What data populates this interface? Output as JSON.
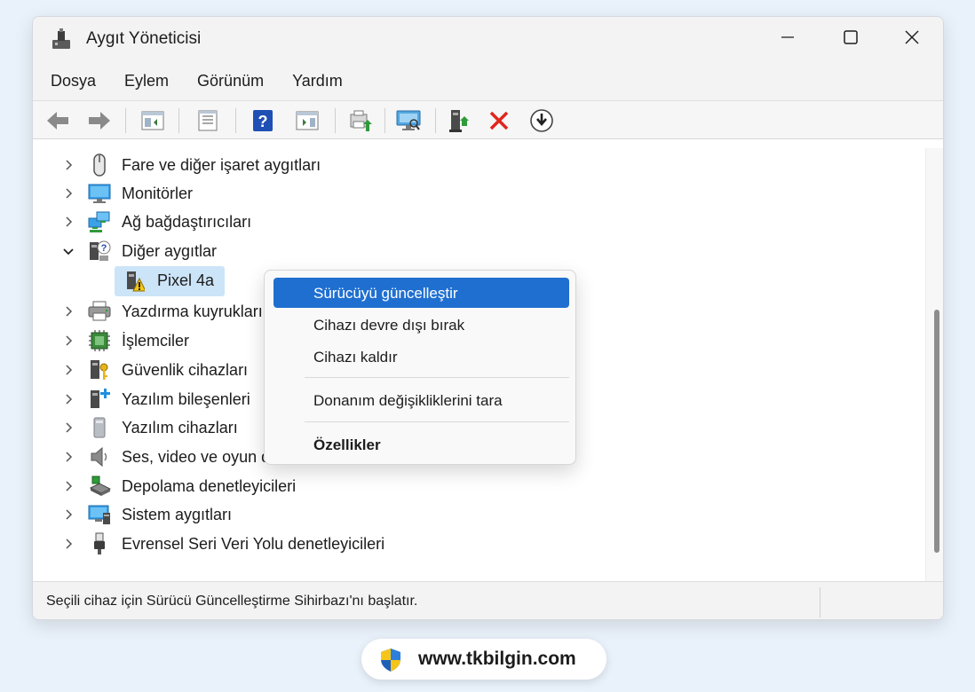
{
  "window": {
    "title": "Aygıt Yöneticisi",
    "app_icon": "device-manager-icon",
    "controls": [
      "minimize-icon",
      "maximize-icon",
      "close-icon"
    ]
  },
  "menu": {
    "items": [
      "Dosya",
      "Eylem",
      "Görünüm",
      "Yardım"
    ]
  },
  "toolbar": {
    "buttons": [
      "back-arrow-icon",
      "forward-arrow-icon",
      "show-hide-console-tree-icon",
      "properties-icon",
      "help-icon",
      "action-pane-icon",
      "update-driver-icon",
      "scan-hardware-icon",
      "enable-device-icon",
      "uninstall-device-icon",
      "download-driver-icon"
    ]
  },
  "tree": {
    "items": [
      {
        "label": "Fare ve diğer işaret aygıtları",
        "icon": "mouse-icon",
        "expanded": false
      },
      {
        "label": "Monitörler",
        "icon": "monitor-icon",
        "expanded": false
      },
      {
        "label": "Ağ bağdaştırıcıları",
        "icon": "network-adapter-icon",
        "expanded": false
      },
      {
        "label": "Diğer aygıtlar",
        "icon": "other-devices-icon",
        "expanded": true
      },
      {
        "label": "Pixel 4a",
        "icon": "warning-device-icon",
        "child": true,
        "selected": true
      },
      {
        "label": "Yazdırma kuyrukları",
        "icon": "printer-icon",
        "expanded": false
      },
      {
        "label": "İşlemciler",
        "icon": "processor-icon",
        "expanded": false
      },
      {
        "label": "Güvenlik cihazları",
        "icon": "security-device-icon",
        "expanded": false
      },
      {
        "label": "Yazılım bileşenleri",
        "icon": "software-component-icon",
        "expanded": false
      },
      {
        "label": "Yazılım cihazları",
        "icon": "software-device-icon",
        "expanded": false
      },
      {
        "label": "Ses, video ve oyun d",
        "icon": "speaker-icon",
        "expanded": false
      },
      {
        "label": "Depolama denetleyicileri",
        "icon": "storage-controller-icon",
        "expanded": false
      },
      {
        "label": "Sistem aygıtları",
        "icon": "system-device-icon",
        "expanded": false
      },
      {
        "label": "Evrensel Seri Veri Yolu denetleyicileri",
        "icon": "usb-icon",
        "expanded": false
      }
    ]
  },
  "context_menu": {
    "items": [
      {
        "label": "Sürücüyü güncelleştir",
        "active": true
      },
      {
        "label": "Cihazı devre dışı bırak"
      },
      {
        "label": "Cihazı kaldır"
      },
      {
        "label": "Donanım değişikliklerini tara"
      },
      {
        "label": "Özellikler",
        "bold": true
      }
    ]
  },
  "status": {
    "text": "Seçili cihaz için Sürücü Güncelleştirme Sihirbazı'nı başlatır."
  },
  "badge": {
    "text": "www.tkbilgin.com",
    "icon": "shield-icon"
  },
  "colors": {
    "accent": "#1f6fd1",
    "selection": "#cce4f7",
    "background": "#e9f1fa"
  }
}
